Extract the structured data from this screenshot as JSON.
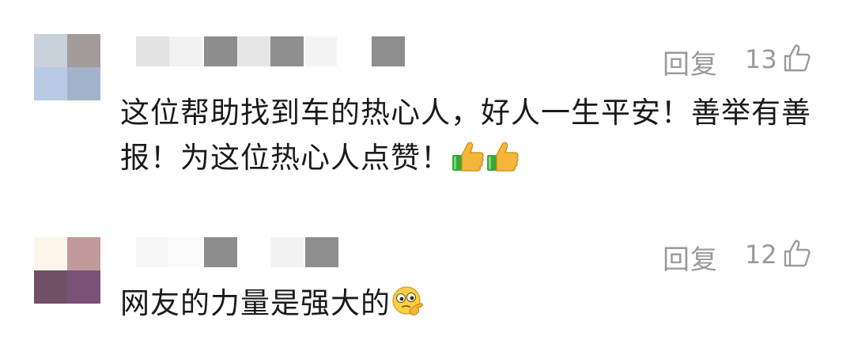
{
  "comments": [
    {
      "reply_label": "回复",
      "like_count": "13",
      "text_line1": "这位帮助找到车的热心人，好人一生平安！善举有善",
      "text_line2": "报！为这位热心人点赞！",
      "emojis": [
        "thumbs-up-emoji",
        "thumbs-up-emoji"
      ],
      "avatar_colors": [
        "#c8d0da",
        "#a39c9b",
        "#b8c9e3",
        "#a4b2cc"
      ]
    },
    {
      "reply_label": "回复",
      "like_count": "12",
      "text_line1": "网友的力量是强大的",
      "emojis": [
        "thinking-face-emoji"
      ],
      "avatar_colors": [
        "#fdf5ea",
        "#c2999a",
        "#6f5066",
        "#7a5278"
      ]
    }
  ],
  "colors": {
    "meta_gray": "#9a9a9a",
    "text": "#1a1a1a",
    "blur_gray": "#8e8e8e",
    "blur_light": "#e4e4e4"
  }
}
